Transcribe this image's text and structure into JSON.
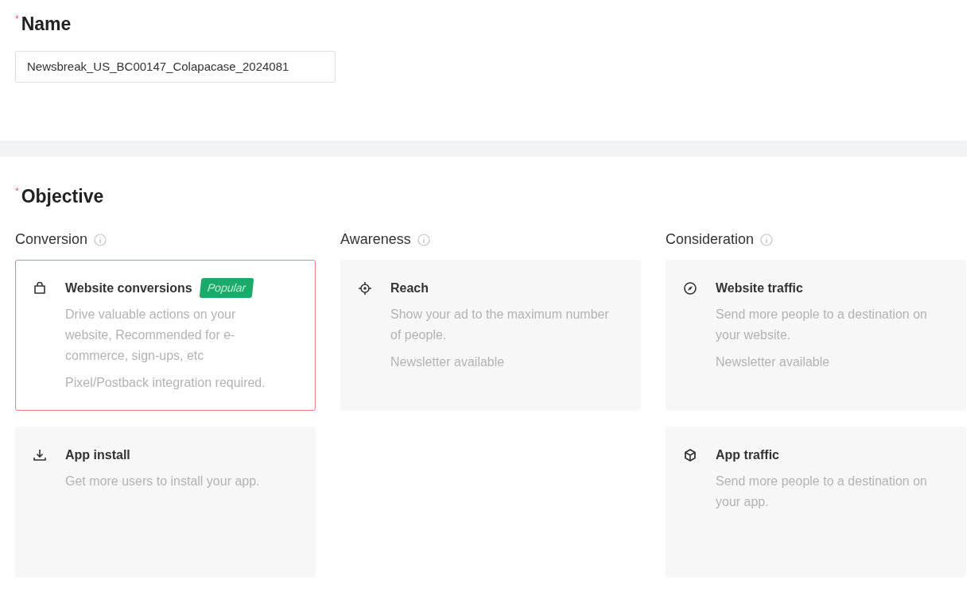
{
  "name_section": {
    "title": "Name",
    "required_mark": "*",
    "value": "Newsbreak_US_BC00147_Colapacase_2024081"
  },
  "objective_section": {
    "title": "Objective",
    "required_mark": "*",
    "columns": [
      {
        "label": "Conversion",
        "cards": [
          {
            "kind": "bag",
            "title": "Website conversions",
            "badge": "Popular",
            "description": "Drive valuable actions on your website, Recommended for e-commerce, sign-ups, etc",
            "note": "Pixel/Postback integration required.",
            "selected": true
          },
          {
            "kind": "download",
            "title": "App install",
            "description": "Get more users to install your app.",
            "selected": false
          }
        ]
      },
      {
        "label": "Awareness",
        "cards": [
          {
            "kind": "target",
            "title": "Reach",
            "description": "Show your ad to the maximum number of people.",
            "note": "Newsletter available",
            "selected": false
          }
        ]
      },
      {
        "label": "Consideration",
        "cards": [
          {
            "kind": "compass",
            "title": "Website traffic",
            "description": "Send more people to a destination on your website.",
            "note": "Newsletter available",
            "selected": false
          },
          {
            "kind": "cube",
            "title": "App traffic",
            "description": "Send more people to a destination on your app.",
            "selected": false
          }
        ]
      }
    ]
  }
}
